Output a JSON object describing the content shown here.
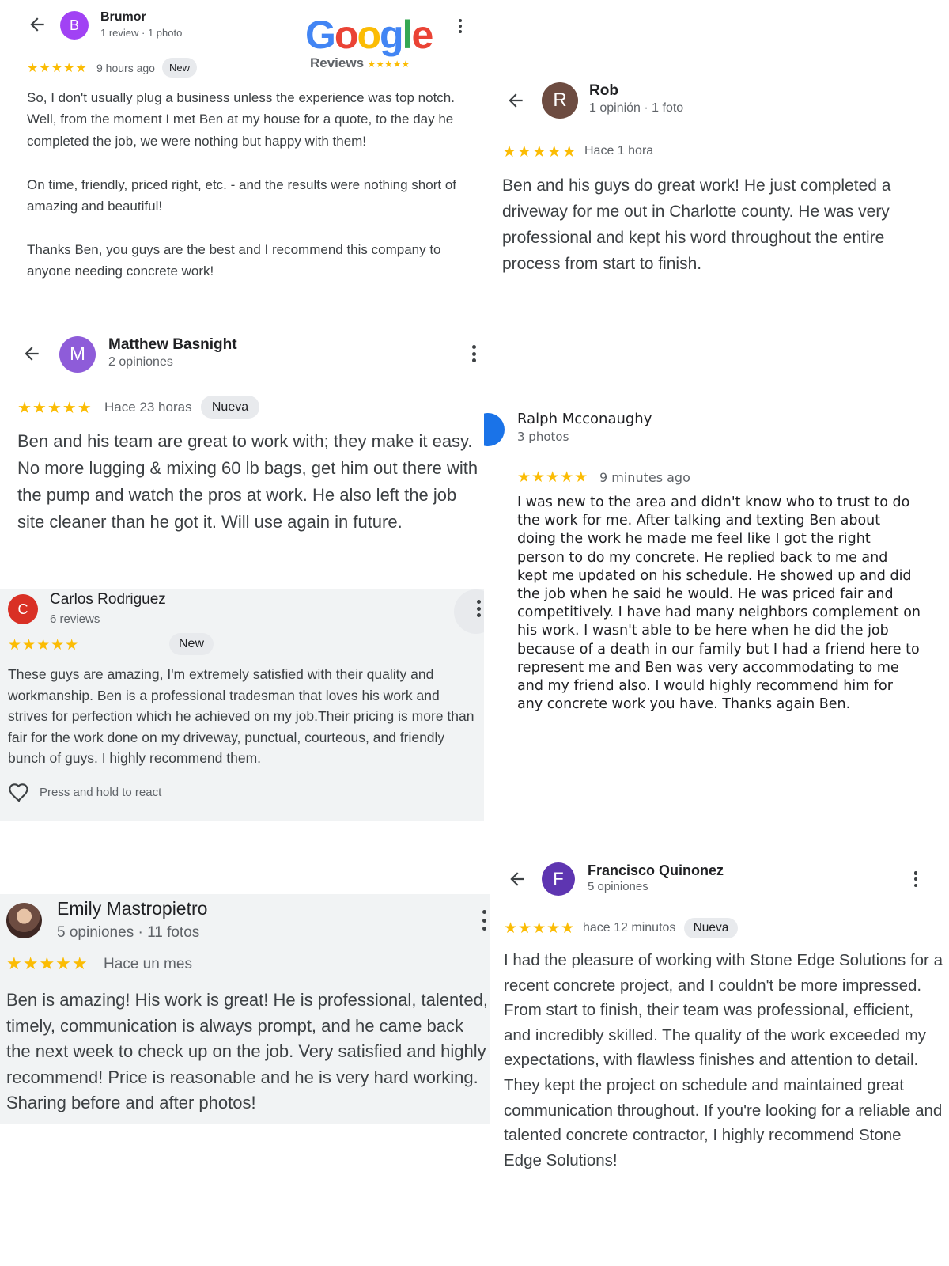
{
  "google_logo": {
    "text": "Google",
    "reviews_label": "Reviews",
    "stars": "★★★★★",
    "letter_colors": [
      "#4285F4",
      "#EA4335",
      "#FBBC05",
      "#4285F4",
      "#34A853",
      "#EA4335"
    ]
  },
  "colors": {
    "star": "#fbbc04",
    "text_dark": "#202124",
    "text_muted": "#5f6368",
    "badge_bg": "#e8eaed",
    "card_gray": "#f1f3f4"
  },
  "reviews": [
    {
      "author": "Brumor",
      "initial": "B",
      "avatar_color": "#a142f4",
      "meta": "1 review · 1 photo",
      "stars": "★★★★★",
      "time": "9 hours ago",
      "badge": "New",
      "text": "So, I don't usually plug a business unless the experience was top notch. Well, from the moment I met Ben at my house for a quote, to the day he completed the job, we were nothing but happy with them!\n\nOn time, friendly, priced right, etc. - and the results were nothing short of amazing and beautiful!\n\nThanks Ben, you guys are the best and I recommend this company to anyone needing concrete work!"
    },
    {
      "author": "Rob",
      "initial": "R",
      "avatar_color": "#6d4c41",
      "meta": "1 opinión · 1 foto",
      "stars": "★★★★★",
      "time": "Hace 1 hora",
      "text": "Ben and his guys do great work! He just completed a driveway for me out in Charlotte county. He was very professional and kept his word throughout the entire process from start to finish."
    },
    {
      "author": "Matthew Basnight",
      "initial": "M",
      "avatar_color": "#8e5cd9",
      "meta": "2 opiniones",
      "stars": "★★★★★",
      "time": "Hace 23 horas",
      "badge": "Nueva",
      "text": "Ben and his team are great to work with; they make it easy. No more lugging & mixing 60 lb bags, get him out there with the pump and watch the pros at work. He also left the job site cleaner than he got it. Will use again in future."
    },
    {
      "author": "Ralph Mcconaughy",
      "meta": "3 photos",
      "avatar_color": "#1a73e8",
      "stars": "★★★★★",
      "time": "9 minutes ago",
      "text": "I was new to the area and didn't know who to trust to do the work for me. After talking and texting Ben about doing the work he made me feel like I got the right person to do my concrete. He replied back to me and kept me updated on his schedule. He showed up and did the job when he said he would. He was priced fair and competitively. I have had many neighbors complement on his work. I wasn't able to be here when he did the job because of a death in our family but I had a friend here to represent me and Ben was very accommodating to me and my friend also. I would highly recommend him for any concrete work you have. Thanks again Ben."
    },
    {
      "author": "Carlos Rodriguez",
      "initial": "C",
      "avatar_color": "#d93025",
      "meta": "6 reviews",
      "stars": "★★★★★",
      "badge": "New",
      "text": "These guys are amazing, I'm extremely satisfied with their quality and workmanship. Ben is a professional tradesman that loves his work and strives for perfection which he achieved on my job.Their pricing is more than fair for the work done on my driveway, punctual, courteous, and friendly bunch of guys. I highly recommend them.",
      "react_label": "Press and hold to react"
    },
    {
      "author": "Emily Mastropietro",
      "avatar_color": "#8d6e63",
      "meta": "5 opiniones · 11 fotos",
      "stars": "★★★★★",
      "time": "Hace un mes",
      "text": "Ben is amazing! His work is great! He is professional, talented, timely, communication is always prompt, and he came back the next week to check up on the job. Very satisfied and highly recommend! Price is reasonable and he is very hard working. Sharing before and after photos!"
    },
    {
      "author": "Francisco Quinonez",
      "initial": "F",
      "avatar_color": "#5e35b1",
      "meta": "5 opiniones",
      "stars": "★★★★★",
      "time": "hace 12 minutos",
      "badge": "Nueva",
      "text": "I had the pleasure of working with Stone Edge Solutions for a recent concrete project, and I couldn't be more impressed. From start to finish, their team was professional, efficient, and incredibly skilled. The quality of the work exceeded my expectations, with flawless finishes and attention to detail. They kept the project on schedule and maintained great communication throughout. If you're looking for a reliable and talented concrete contractor, I highly recommend Stone Edge Solutions!"
    }
  ]
}
